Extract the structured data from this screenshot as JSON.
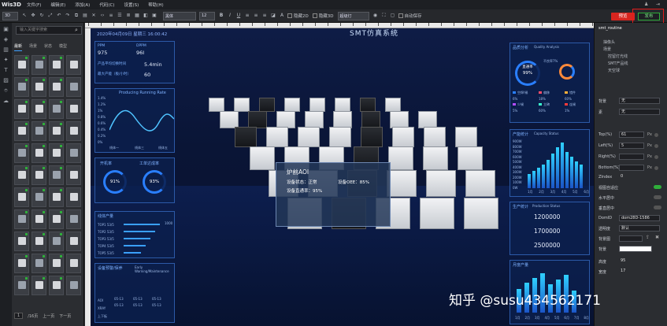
{
  "app": {
    "logo": "Wis3D"
  },
  "menu": [
    "文件(F)",
    "编辑(E)",
    "添加(A)",
    "代码(C)",
    "设置(S)",
    "帮助(H)"
  ],
  "toolbar": {
    "view_mode": "3D",
    "font": "黑体",
    "font_size": "12",
    "hide2d": "隐藏2D",
    "hide3d": "隐藏3D",
    "light": "超级灯",
    "auto_save": "自动保存"
  },
  "actions": {
    "preview": "预览",
    "publish": "发布"
  },
  "left": {
    "search_placeholder": "输入关键字搜索",
    "tabs": [
      "最新",
      "场景",
      "状态",
      "模型"
    ],
    "page": "/16页",
    "prev": "上一页",
    "next": "下一页",
    "page_no": "1"
  },
  "scene": {
    "title": "SMT仿真系统",
    "date": "2020年04月09日  星期三  16:00:42",
    "ppm_label": "PPM",
    "ppm": "975",
    "dppm_label": "DPPM",
    "dppm": "96I",
    "change_label": "产品平均切换时间",
    "change_val": "5.4min",
    "eff_label": "最大产能（板/小时）",
    "eff_val": "60",
    "chart_title": "Producing Running Rate",
    "y_ticks": [
      "1.4%",
      "1.2%",
      "1%",
      "0.8%",
      "0.6%",
      "0.4%",
      "0.2%",
      "0%"
    ],
    "x_ticks": [
      "线体一",
      "线体三",
      "线体五"
    ],
    "ring1_label": "开机率",
    "ring1": "91%",
    "ring2_label": "工单达成率",
    "ring2": "93%",
    "line_title": "线体产量",
    "tops": [
      "TOP1 53/5",
      "TOP2 53/5",
      "TOP3 53/5",
      "TOP4 53/5",
      "TOP5 53/5"
    ],
    "top_val": "1000",
    "alarm_title": "设备预警/保养",
    "alarm_sub": "Early Warning/Maintenance",
    "table_rows": [
      "AOI",
      "XRAY",
      "上下板"
    ],
    "table_cells": [
      "05-13",
      "05-13",
      "05-13",
      "05-13",
      "05-13",
      "05-13"
    ],
    "quality_title": "品质分析",
    "quality_sub": "Quality Analysis",
    "ring3": "99%",
    "ring3_label": "直通率",
    "ring4_label": "不良率7%",
    "q_legend": [
      "空焊/锡",
      "偏移",
      "错件",
      "少锡",
      "立碑",
      "连锡"
    ],
    "q_vals": [
      "6%",
      "18%",
      "60%",
      "5%",
      "60%",
      "1%"
    ],
    "cap_title": "产能统计",
    "cap_sub": "Capacity Status",
    "cap_y": [
      "900W",
      "800W",
      "700W",
      "600W",
      "500W",
      "400W",
      "300W",
      "200W",
      "100W",
      "0W"
    ],
    "cap_x": [
      "1月",
      "2月",
      "3月",
      "4月",
      "5月",
      "6月"
    ],
    "prod_title": "生产统计",
    "prod_sub": "Production Status",
    "prod_vals": [
      "1200000",
      "1700000",
      "2500000"
    ],
    "month_title": "月度产量",
    "months": [
      "1月",
      "2月",
      "3月",
      "4月",
      "5月",
      "6月",
      "7月",
      "8月"
    ],
    "popup": {
      "title": "炉前AOI",
      "state": "设备状态：正常",
      "oee": "设备OEE：85%",
      "pass": "设备直通率：95%"
    }
  },
  "right": {
    "name": "smt_routine",
    "tree": [
      "抽像头",
      "场景",
      "控留灯光线",
      "SMT产品线",
      "天空球"
    ],
    "bg_label": "背景",
    "bg_val": "无",
    "border_label": "素",
    "border_val": "无",
    "top_label": "Top(%)",
    "top": "61",
    "left_label": "Left(%)",
    "left": "5",
    "right_label": "Right(%)",
    "bottom_label": "Bottom(%)",
    "zindex_label": "ZIndex",
    "zindex": "0",
    "px": "Px",
    "t1": "视图自适应",
    "t2": "水平居中",
    "t3": "垂直居中",
    "domid_label": "DomID",
    "domid": "dom28D-1586",
    "transp_label": "透明度",
    "transp": "默认",
    "bgimg_label": "背景图",
    "bgcolor_label": "背景",
    "height_label": "高度",
    "height": "95",
    "width_label": "宽度",
    "width": "17"
  },
  "watermark": "知乎 @susu434562171"
}
